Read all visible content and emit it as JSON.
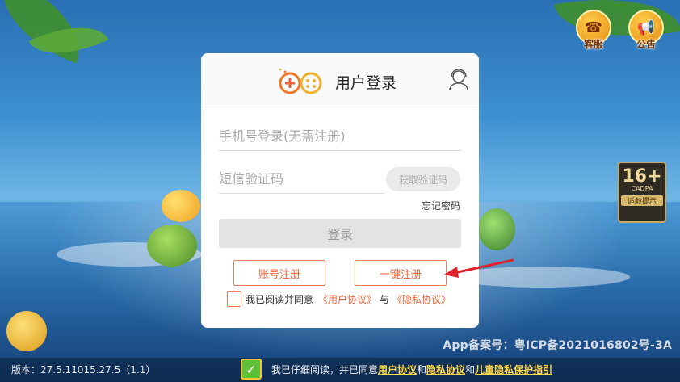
{
  "header": {
    "service_label": "客服",
    "notice_label": "公告"
  },
  "age_rating": {
    "value": "16+",
    "org": "CADPA",
    "tip": "适龄提示"
  },
  "login_panel": {
    "title": "用户登录",
    "phone_placeholder": "手机号登录(无需注册)",
    "code_placeholder": "短信验证码",
    "get_code_label": "获取验证码",
    "forgot_label": "忘记密码",
    "login_label": "登录",
    "account_register_label": "账号注册",
    "quick_register_label": "一键注册",
    "agree_text": "我已阅读并同意",
    "user_agreement": "《用户协议》",
    "and_text": "与",
    "privacy_agreement": "《隐私协议》"
  },
  "footer": {
    "icp": "App备案号：粤ICP备2021016802号-3A",
    "version": "版本：27.5.11015.27.5（1.1）",
    "agree_text": "我已仔细阅读，并已同意",
    "user_agreement": "用户协议",
    "and_text_1": "和",
    "privacy_agreement": "隐私协议",
    "and_text_2": "和",
    "child_privacy": "儿童隐私保护指引"
  },
  "colors": {
    "accent": "#f0633a",
    "link_yellow": "#ffd84a",
    "check_green": "#5fbf3a"
  }
}
